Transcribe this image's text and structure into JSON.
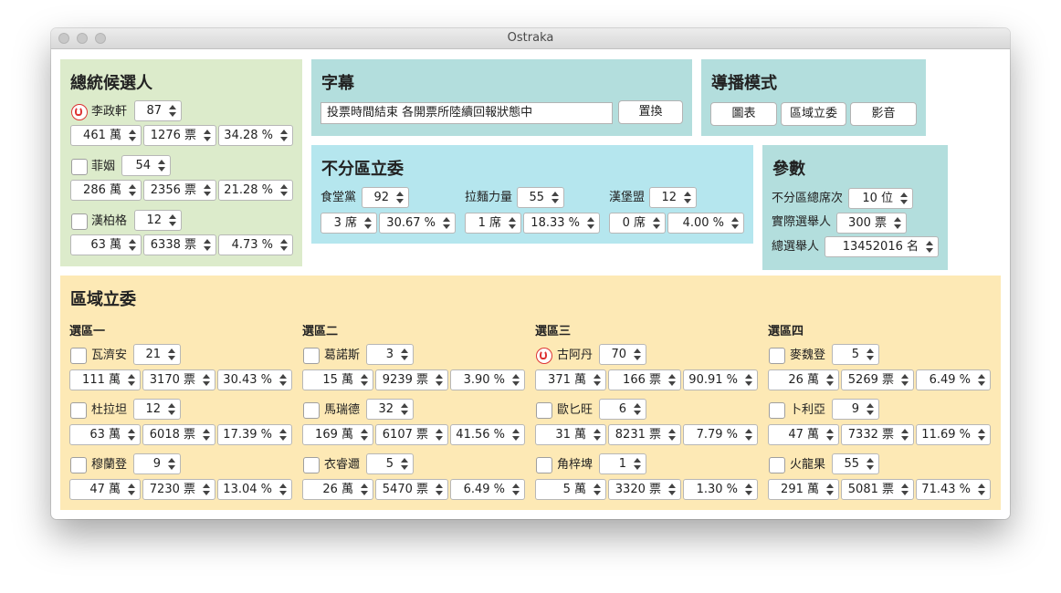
{
  "window": {
    "title": "Ostraka"
  },
  "president": {
    "heading": "總統候選人",
    "candidates": [
      {
        "name": "李政軒",
        "winner": true,
        "number": "87",
        "amount": "461 萬",
        "votes": "1276 票",
        "percent": "34.28 %"
      },
      {
        "name": "菲姻",
        "winner": false,
        "number": "54",
        "amount": "286 萬",
        "votes": "2356 票",
        "percent": "21.28 %"
      },
      {
        "name": "漢柏格",
        "winner": false,
        "number": "12",
        "amount": "63 萬",
        "votes": "6338 票",
        "percent": "4.73 %"
      }
    ]
  },
  "subtitle": {
    "heading": "字幕",
    "value": "投票時間結束 各開票所陸續回報狀態中",
    "replace_label": "置換"
  },
  "broadcast": {
    "heading": "導播模式",
    "buttons": [
      "圖表",
      "區域立委",
      "影音"
    ]
  },
  "party_list": {
    "heading": "不分區立委",
    "parties": [
      {
        "name": "食堂黨",
        "number": "92",
        "seats": "3 席",
        "percent": "30.67 %"
      },
      {
        "name": "拉麵力量",
        "number": "55",
        "seats": "1 席",
        "percent": "18.33 %"
      },
      {
        "name": "漢堡盟",
        "number": "12",
        "seats": "0 席",
        "percent": "4.00 %"
      }
    ]
  },
  "params": {
    "heading": "參數",
    "rows": [
      {
        "label": "不分區總席次",
        "value": "10 位"
      },
      {
        "label": "實際選舉人",
        "value": "300 票"
      },
      {
        "label": "總選舉人",
        "value": "13452016 名"
      }
    ]
  },
  "district": {
    "heading": "區域立委",
    "districts": [
      {
        "name": "選區一",
        "candidates": [
          {
            "name": "瓦濟安",
            "winner": false,
            "number": "21",
            "amount": "111 萬",
            "votes": "3170 票",
            "percent": "30.43 %"
          },
          {
            "name": "杜拉坦",
            "winner": false,
            "number": "12",
            "amount": "63 萬",
            "votes": "6018 票",
            "percent": "17.39 %"
          },
          {
            "name": "穆蘭登",
            "winner": false,
            "number": "9",
            "amount": "47 萬",
            "votes": "7230 票",
            "percent": "13.04 %"
          }
        ]
      },
      {
        "name": "選區二",
        "candidates": [
          {
            "name": "葛諾斯",
            "winner": false,
            "number": "3",
            "amount": "15 萬",
            "votes": "9239 票",
            "percent": "3.90 %"
          },
          {
            "name": "馬瑞德",
            "winner": false,
            "number": "32",
            "amount": "169 萬",
            "votes": "6107 票",
            "percent": "41.56 %"
          },
          {
            "name": "衣睿邇",
            "winner": false,
            "number": "5",
            "amount": "26 萬",
            "votes": "5470 票",
            "percent": "6.49 %"
          }
        ]
      },
      {
        "name": "選區三",
        "candidates": [
          {
            "name": "古阿丹",
            "winner": true,
            "number": "70",
            "amount": "371 萬",
            "votes": "166 票",
            "percent": "90.91 %"
          },
          {
            "name": "歐匕旺",
            "winner": false,
            "number": "6",
            "amount": "31 萬",
            "votes": "8231 票",
            "percent": "7.79 %"
          },
          {
            "name": "角梓埤",
            "winner": false,
            "number": "1",
            "amount": "5 萬",
            "votes": "3320 票",
            "percent": "1.30 %"
          }
        ]
      },
      {
        "name": "選區四",
        "candidates": [
          {
            "name": "麥魏登",
            "winner": false,
            "number": "5",
            "amount": "26 萬",
            "votes": "5269 票",
            "percent": "6.49 %"
          },
          {
            "name": "卜利亞",
            "winner": false,
            "number": "9",
            "amount": "47 萬",
            "votes": "7332 票",
            "percent": "11.69 %"
          },
          {
            "name": "火龍果",
            "winner": false,
            "number": "55",
            "amount": "291 萬",
            "votes": "5081 票",
            "percent": "71.43 %"
          }
        ]
      }
    ]
  }
}
